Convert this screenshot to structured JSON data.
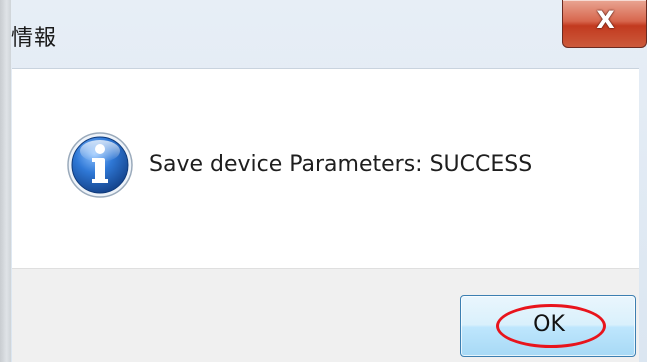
{
  "dialog": {
    "title": "情報",
    "close_glyph": "X",
    "icon": "information-icon",
    "message": "Save device Parameters: SUCCESS",
    "ok_label": "OK"
  },
  "colors": {
    "close_button": "#c23a1f",
    "ok_button": "#bee6fd",
    "info_icon": "#1f5fb0",
    "highlight": "#e8141c"
  }
}
